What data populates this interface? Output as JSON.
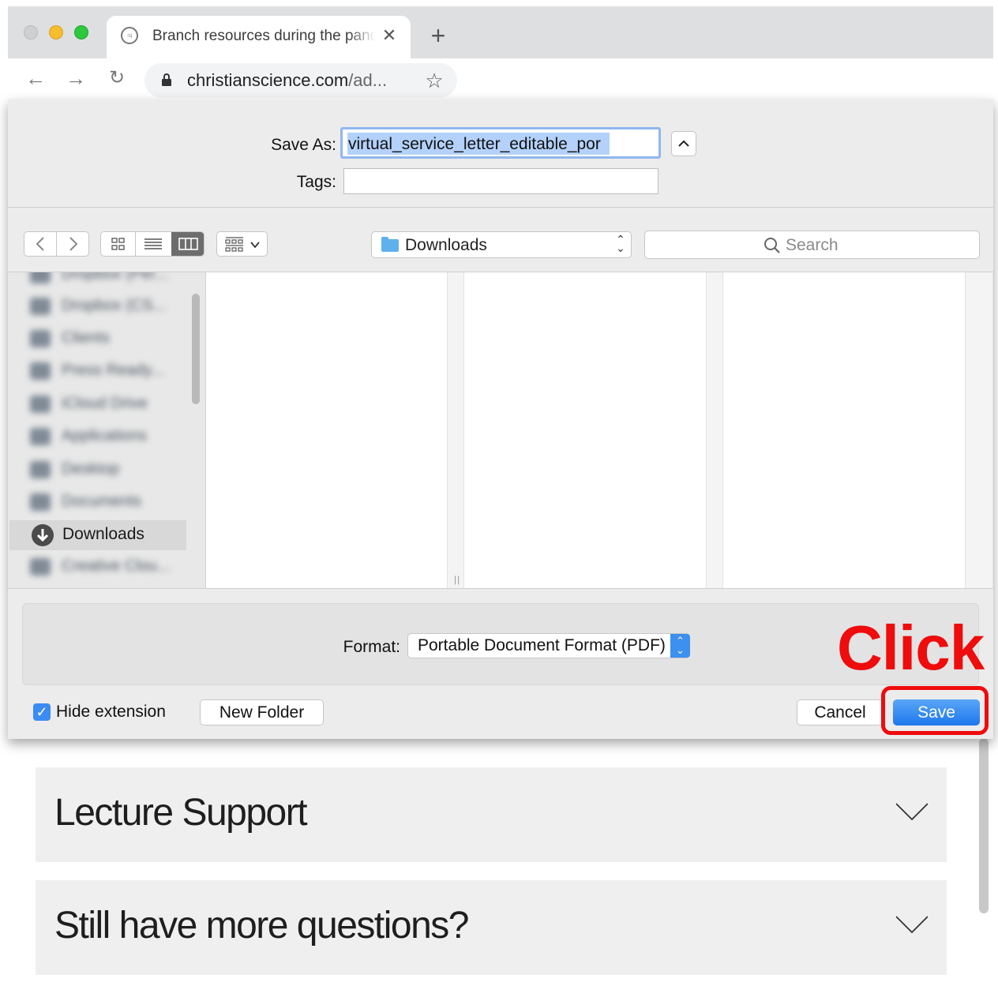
{
  "browser": {
    "tab_title": "Branch resources during the pandemic",
    "tab_close_icon": "close-icon",
    "url_host": "christianscience.com",
    "url_path": "/ad...",
    "new_tab_label": "+"
  },
  "dialog": {
    "save_as_label": "Save As:",
    "filename_value": "virtual_service_letter_editable_por",
    "tags_label": "Tags:",
    "tags_value": "",
    "location": "Downloads",
    "search_placeholder": "Search",
    "sidebar": {
      "blurred_items": [
        "Dropbox (Per...",
        "Dropbox (CS...",
        "Clients",
        "Press Ready...",
        "iCloud Drive",
        "Applications",
        "Desktop",
        "Documents"
      ],
      "selected_item": "Downloads",
      "after_item": "Creative Clou..."
    },
    "format_label": "Format:",
    "format_value": "Portable Document Format (PDF)",
    "hide_extension_label": "Hide extension",
    "hide_extension_checked": true,
    "new_folder_label": "New Folder",
    "cancel_label": "Cancel",
    "save_label": "Save",
    "accent_color": "#2f86f0"
  },
  "page": {
    "accordion": [
      {
        "title": "Lecture Support"
      },
      {
        "title": "Still have more questions?"
      }
    ]
  },
  "annotation": {
    "text": "Click",
    "color": "#ee0c0c"
  }
}
